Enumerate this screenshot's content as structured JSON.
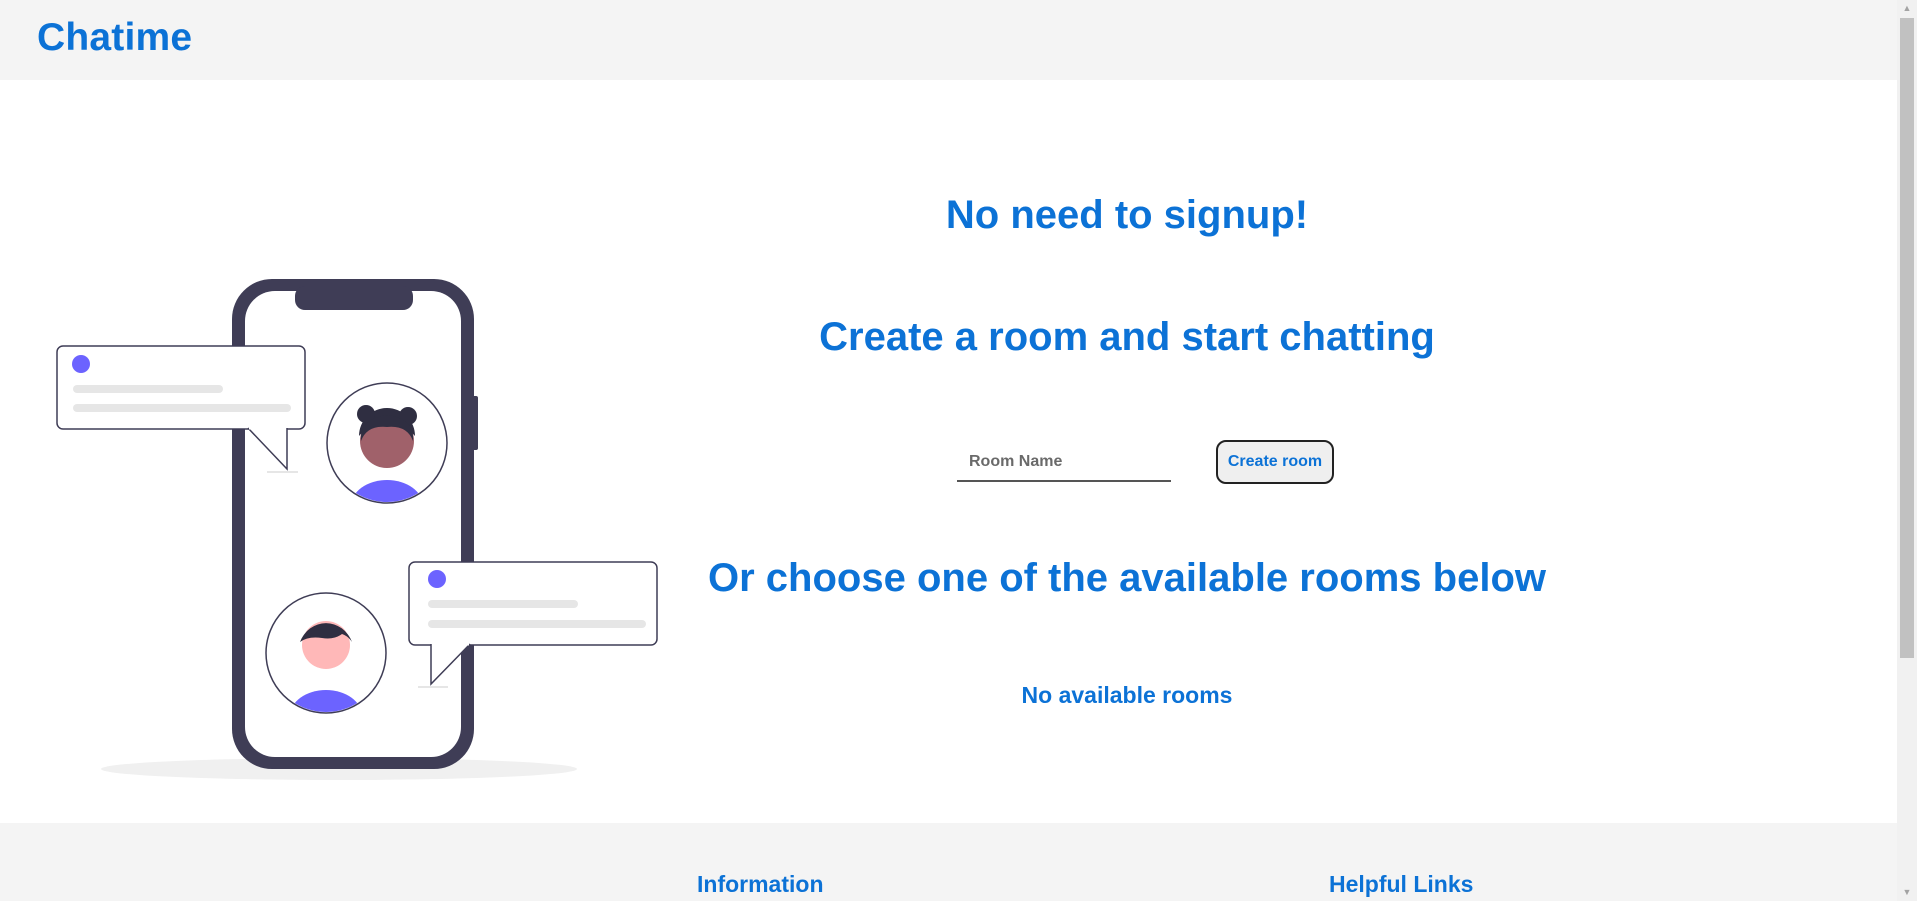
{
  "header": {
    "logo": "Chatime"
  },
  "main": {
    "headline": "No need to signup!",
    "subheadline": "Create a room and start chatting",
    "room_input": {
      "placeholder": "Room Name",
      "value": ""
    },
    "create_button_label": "Create room",
    "rooms_heading": "Or choose one of the available rooms below",
    "rooms_empty_message": "No available rooms"
  },
  "footer": {
    "information_heading": "Information",
    "helpful_links_heading": "Helpful Links"
  },
  "colors": {
    "accent": "#0c72d6",
    "header_bg": "#f4f4f4",
    "phone_frame": "#3f3d56",
    "avatar_accent": "#6c63ff"
  },
  "icons": {
    "illustration": "phone-chat-illustration"
  }
}
